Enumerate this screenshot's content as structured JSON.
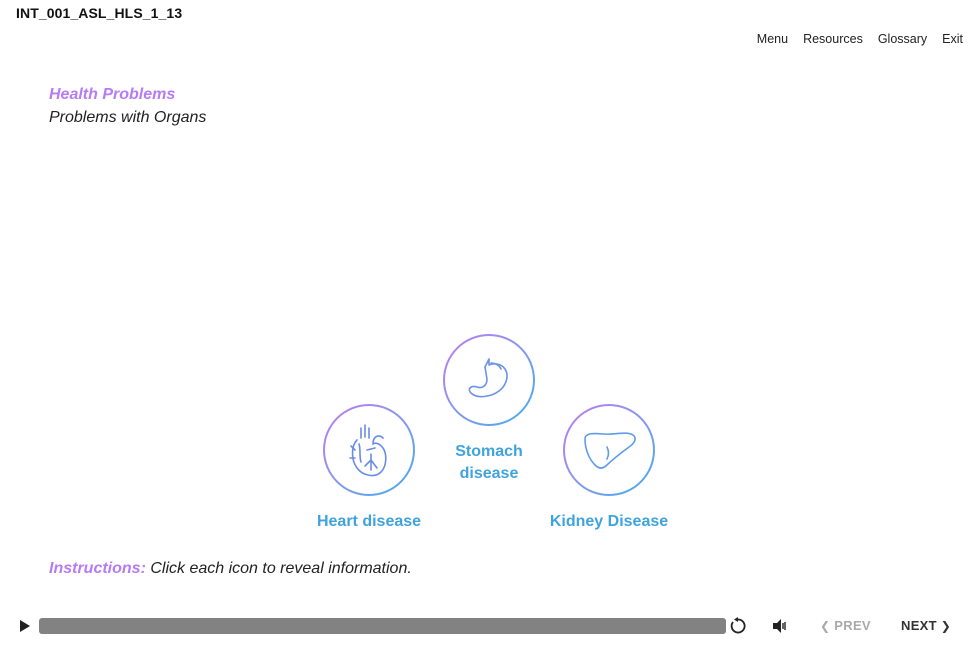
{
  "header": {
    "course_id": "INT_001_ASL_HLS_1_13",
    "nav": [
      "Menu",
      "Resources",
      "Glossary",
      "Exit"
    ]
  },
  "content": {
    "title": "Health Problems",
    "subtitle": "Problems with Organs",
    "organs": [
      {
        "label": "Heart disease",
        "icon": "heart-icon"
      },
      {
        "label": "Stomach disease",
        "icon": "stomach-icon"
      },
      {
        "label": "Kidney Disease",
        "icon": "kidney-icon"
      }
    ],
    "instructions_lead": "Instructions:",
    "instructions_text": "Click each icon to reveal information."
  },
  "player": {
    "prev_label": "PREV",
    "next_label": "NEXT",
    "prev_enabled": false,
    "next_enabled": true
  },
  "colors": {
    "accent_purple": "#b77cf2",
    "accent_blue": "#3fa4dd",
    "progress_bar": "#828282"
  }
}
